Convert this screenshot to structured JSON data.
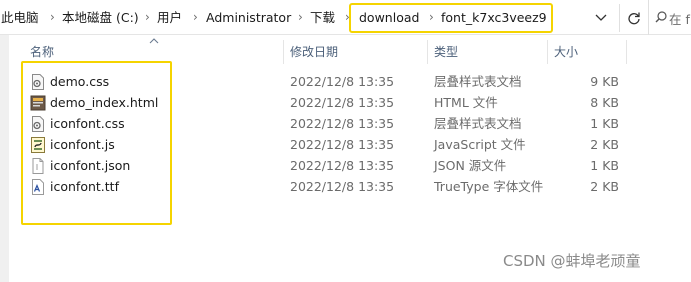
{
  "address_bar": {
    "crumbs": [
      "此电脑",
      "本地磁盘 (C:)",
      "用户",
      "Administrator",
      "下载",
      "download",
      "font_k7xc3veez9"
    ],
    "search_placeholder": "在 f"
  },
  "columns": {
    "name": "名称",
    "date": "修改日期",
    "type": "类型",
    "size": "大小"
  },
  "files": [
    {
      "name": "demo.css",
      "date": "2022/12/8 13:35",
      "type": "层叠样式表文档",
      "size": "9 KB",
      "icon": "css-file-icon"
    },
    {
      "name": "demo_index.html",
      "date": "2022/12/8 13:35",
      "type": "HTML 文件",
      "size": "8 KB",
      "icon": "html-file-icon"
    },
    {
      "name": "iconfont.css",
      "date": "2022/12/8 13:35",
      "type": "层叠样式表文档",
      "size": "1 KB",
      "icon": "css-file-icon"
    },
    {
      "name": "iconfont.js",
      "date": "2022/12/8 13:35",
      "type": "JavaScript 文件",
      "size": "2 KB",
      "icon": "js-file-icon"
    },
    {
      "name": "iconfont.json",
      "date": "2022/12/8 13:35",
      "type": "JSON 源文件",
      "size": "1 KB",
      "icon": "json-file-icon"
    },
    {
      "name": "iconfont.ttf",
      "date": "2022/12/8 13:35",
      "type": "TrueType 字体文件",
      "size": "2 KB",
      "icon": "ttf-file-icon"
    }
  ],
  "watermark": "CSDN @蚌埠老顽童",
  "colors": {
    "highlight": "#f5d400",
    "header_text": "#4c607a"
  }
}
